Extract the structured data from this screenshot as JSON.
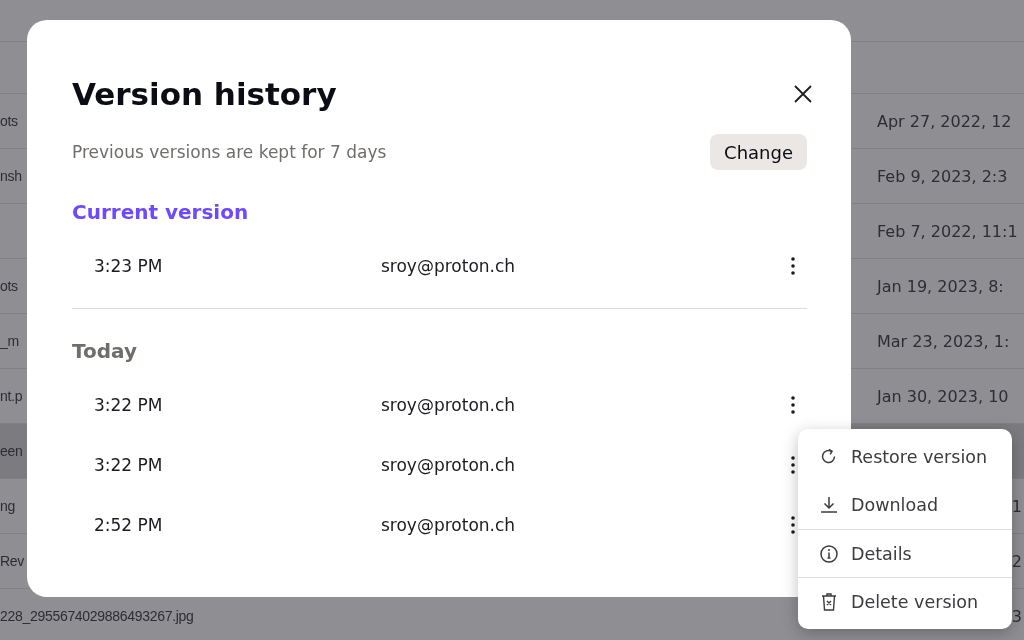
{
  "file_list": {
    "rows": [
      {
        "name": "ots",
        "modified": "Apr 27, 2022, 12",
        "selected": false
      },
      {
        "name": "nsh",
        "modified": "Feb 9, 2023, 2:3",
        "selected": false
      },
      {
        "modified": "Feb 7, 2022, 11:1",
        "selected": false
      },
      {
        "name": "ots",
        "modified": "Jan 19, 2023, 8:",
        "selected": false
      },
      {
        "name": "_m",
        "modified": "Mar 23, 2023, 1:",
        "selected": false
      },
      {
        "name": "nt.p",
        "modified": "Jan 30, 2023, 10",
        "selected": false
      },
      {
        "name": "een",
        "selected": true
      },
      {
        "name": "ng",
        "modified_tail": "1",
        "selected": false
      },
      {
        "name": "Rev",
        "modified_tail": "2",
        "selected": false
      },
      {
        "name": "228_2955674029886493267.jpg",
        "modified_tail": "3",
        "selected": false
      }
    ]
  },
  "dialog": {
    "title": "Version history",
    "subtitle": "Previous versions are kept for 7 days",
    "change_button": "Change",
    "groups": [
      {
        "title": "Current version",
        "kind": "current",
        "versions": [
          {
            "time": "3:23 PM",
            "author": "sroy@proton.ch"
          }
        ]
      },
      {
        "title": "Today",
        "kind": "past",
        "versions": [
          {
            "time": "3:22 PM",
            "author": "sroy@proton.ch"
          },
          {
            "time": "3:22 PM",
            "author": "sroy@proton.ch"
          },
          {
            "time": "2:52 PM",
            "author": "sroy@proton.ch"
          }
        ]
      }
    ]
  },
  "context_menu": {
    "items": [
      {
        "label": "Restore version",
        "kind": "restore"
      },
      {
        "label": "Download",
        "kind": "download"
      },
      {
        "label": "Details",
        "kind": "info"
      },
      {
        "label": "Delete version",
        "kind": "delete"
      }
    ]
  }
}
